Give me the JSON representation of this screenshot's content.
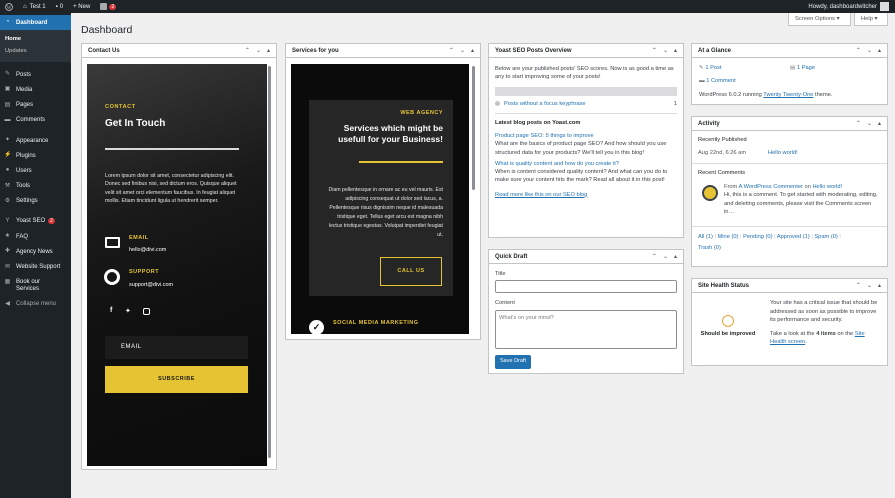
{
  "adminbar": {
    "site": "Test 1",
    "comments": "0",
    "new": "+ New",
    "yoast_badge": "2",
    "howdy": "Howdy, dashboardwitcher"
  },
  "menu": {
    "dashboard": "Dashboard",
    "home": "Home",
    "updates": "Updates",
    "posts": "Posts",
    "media": "Media",
    "pages": "Pages",
    "comments": "Comments",
    "appearance": "Appearance",
    "plugins": "Plugins",
    "users": "Users",
    "tools": "Tools",
    "settings": "Settings",
    "yoast": "Yoast SEO",
    "yoast_badge": "2",
    "faq": "FAQ",
    "agency_news": "Agency News",
    "website_support": "Website Support",
    "book_our_services": "Book our Services",
    "collapse": "Collapse menu"
  },
  "buttons": {
    "screen_options": "Screen Options ▾",
    "help": "Help ▾"
  },
  "page": {
    "title": "Dashboard"
  },
  "contact": {
    "title": "Contact Us",
    "eyebrow": "CONTACT",
    "heading": "Get In Touch",
    "body": "Lorem ipsum dolor sit amet, consectetur adipiscing elit. Donec sed finibus nisi, sed dictum eros. Quisque aliquet velit sit amet orci elementum faucibus. In feugiat aliquet mollis. Etiam tincidunt ligula ut hendrerit semper.",
    "email_label": "EMAIL",
    "email": "hello@divi.com",
    "support_label": "SUPPORT",
    "support": "support@divi.com",
    "email_field": "EMAIL",
    "subscribe": "SUBSCRIBE"
  },
  "services": {
    "title": "Services for you",
    "eyebrow": "WEB AGENCY",
    "heading": "Services which might be usefull for your Business!",
    "body": "Diam pellentesque in ornare ac eu vel mauris. Est adipiscing consequat ut dolor sed lacus, a. Pellentesque risus dignissim neque id malesuada tristique eget. Tellus eget arcu est magna nibh lectus tristique egestas. Volutpat imperdiet feugiat ut.",
    "cta": "CALL US",
    "footer": "SOCIAL MEDIA MARKETING"
  },
  "yoast": {
    "title": "Yoast SEO Posts Overview",
    "intro": "Below are your published posts' SEO scores. Now is as good a time as any to start improving some of your posts!",
    "row_label": "Posts without a focus keyphrase",
    "row_count": "1",
    "latest_heading": "Latest blog posts on Yoast.com",
    "post1_title": "Product page SEO: 5 things to improve",
    "post1_desc": "What are the basics of product page SEO? And how should you use structured data for your products? We'll tell you in this blog!",
    "post2_title": "What is quality content and how do you create it?",
    "post2_desc": "When is content considered quality content? And what can you do to make sure your content hits the mark? Read all about it in this post!",
    "read_more": "Read more like this on our SEO blog"
  },
  "quickdraft": {
    "title": "Quick Draft",
    "title_label": "Title",
    "content_label": "Content",
    "content_placeholder": "What's on your mind?",
    "save": "Save Draft"
  },
  "glance": {
    "title": "At a Glance",
    "posts": "1 Post",
    "pages": "1 Page",
    "comments": "1 Comment",
    "version_text": "WordPress 6.0.2 running",
    "theme": "Twenty Twenty-One",
    "theme_suffix": "theme."
  },
  "activity": {
    "title": "Activity",
    "recent_published": "Recently Published",
    "date": "Aug 22nd, 6:26 am",
    "post": "Hello world!",
    "recent_comments": "Recent Comments",
    "from": "From",
    "commenter": "A WordPress Commenter",
    "on": "on",
    "on_post": "Hello world!",
    "comment": "Hi, this is a comment. To get started with moderating, editing, and deleting comments, please visit the Comments screen in…",
    "filters": [
      "All (1)",
      "Mine (0)",
      "Pending (0)",
      "Approved (1)",
      "Spam (0)",
      "Trash (0)"
    ]
  },
  "health": {
    "title": "Site Health Status",
    "status": "Should be improved",
    "msg": "Your site has a critical issue that should be addressed as soon as possible to improve its performance and security.",
    "take": "Take a look at the",
    "items": "4 items",
    "on_the": "on the",
    "screen_link": "Site Health screen",
    "dot": "."
  }
}
